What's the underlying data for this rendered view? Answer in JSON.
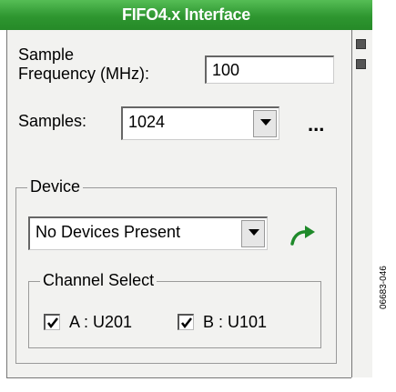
{
  "window": {
    "title": "FIFO4.x Interface"
  },
  "sample_frequency": {
    "label_line1": "Sample",
    "label_line2": "Frequency (MHz):",
    "value": "100"
  },
  "samples": {
    "label": "Samples:",
    "selected": "1024",
    "more_label": "..."
  },
  "device": {
    "group_label": "Device",
    "selected": "No Devices Present",
    "channel_select": {
      "group_label": "Channel Select",
      "channels": [
        {
          "label": "A : U201",
          "checked": true
        },
        {
          "label": "B : U101",
          "checked": true
        }
      ]
    }
  },
  "figure_code": "06683-046",
  "colors": {
    "title_bar": "#2e9630",
    "accent_arrow": "#1f8a2a"
  }
}
